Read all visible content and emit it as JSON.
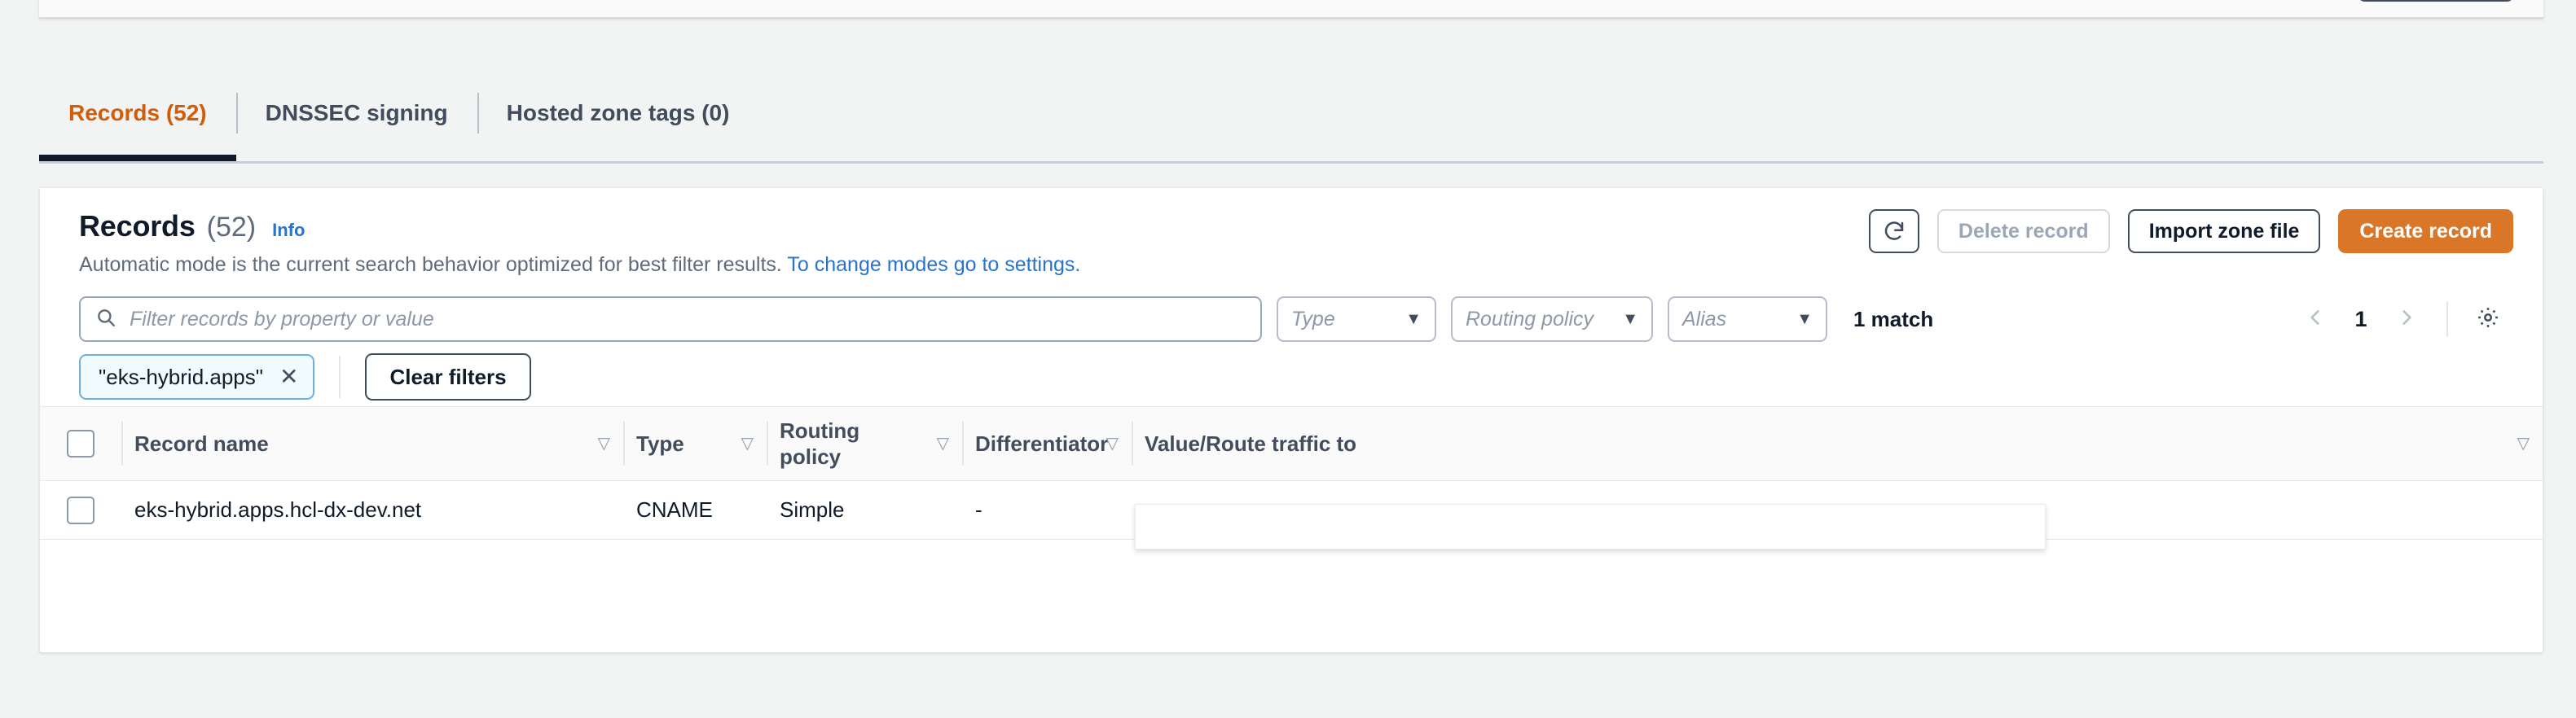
{
  "tabs": [
    {
      "label": "Records (52)",
      "active": true
    },
    {
      "label": "DNSSEC signing",
      "active": false
    },
    {
      "label": "Hosted zone tags (0)",
      "active": false
    }
  ],
  "panel": {
    "title": "Records",
    "count": "(52)",
    "info_link": "Info",
    "subtitle_text": "Automatic mode is the current search behavior optimized for best filter results.",
    "subtitle_link": "To change modes go to settings."
  },
  "actions": {
    "refresh_icon": "refresh-icon",
    "delete_label": "Delete record",
    "import_label": "Import zone file",
    "create_label": "Create record"
  },
  "filters": {
    "search_placeholder": "Filter records by property or value",
    "search_value": "",
    "search_icon": "search-icon",
    "type_label": "Type",
    "routing_label": "Routing policy",
    "alias_label": "Alias",
    "caret": "▼",
    "match_text": "1 match"
  },
  "pagination": {
    "prev_icon": "chevron-left-icon",
    "page": "1",
    "next_icon": "chevron-right-icon",
    "settings_icon": "gear-icon"
  },
  "token_filter": {
    "label": "\"eks-hybrid.apps\"",
    "remove_icon": "✕",
    "clear_label": "Clear filters"
  },
  "table": {
    "columns": [
      {
        "label": "Record name",
        "sort": "▽"
      },
      {
        "label": "Type",
        "sort": "▽"
      },
      {
        "label": "Routing policy",
        "sort": "▽"
      },
      {
        "label": "Differentiator",
        "sort": "▽"
      },
      {
        "label": "Value/Route traffic to",
        "sort": "▽"
      }
    ],
    "rows": [
      {
        "record_name": "eks-hybrid.apps.hcl-dx-dev.net",
        "type": "CNAME",
        "routing_policy": "Simple",
        "differentiator": "-",
        "value": ""
      }
    ]
  },
  "colors": {
    "accent_orange": "#d97628",
    "tab_active": "#d45b07",
    "link_blue": "#2a72cc",
    "text_dark": "#0f1b2a",
    "text_muted": "#5f6b7a"
  }
}
